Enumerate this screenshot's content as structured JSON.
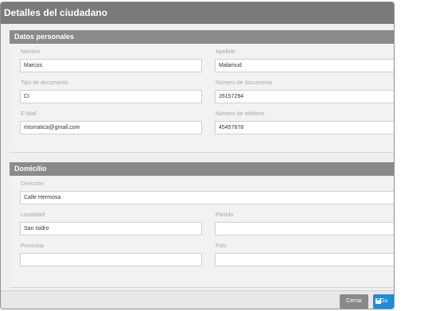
{
  "dialog": {
    "title": "Detalles del ciudadano"
  },
  "personal": {
    "header": "Datos personales",
    "nombre_label": "Nombre",
    "nombre_value": "Marcos",
    "apellido_label": "Apellido",
    "apellido_value": "Malamud",
    "tipo_doc_label": "Tipo de documento",
    "tipo_doc_value": "CI",
    "num_doc_label": "Número de documento",
    "num_doc_value": "26157294",
    "email_label": "E-Mail",
    "email_value": "mismatica@gmail.com",
    "telefono_label": "Número de teléfono",
    "telefono_value": "45457878"
  },
  "domicilio": {
    "header": "Domicilio",
    "direccion_label": "Dirección",
    "direccion_value": "Calle Hermosa",
    "localidad_label": "Localidad",
    "localidad_value": "San Isidro",
    "partido_label": "Partido",
    "partido_value": "",
    "provincia_label": "Provincia",
    "provincia_value": "",
    "pais_label": "País",
    "pais_value": ""
  },
  "footer": {
    "close_label": "Cerrar",
    "save_label": "Gu"
  },
  "colors": {
    "accent": "#1a8fd4",
    "header": "#7a7a7a"
  }
}
